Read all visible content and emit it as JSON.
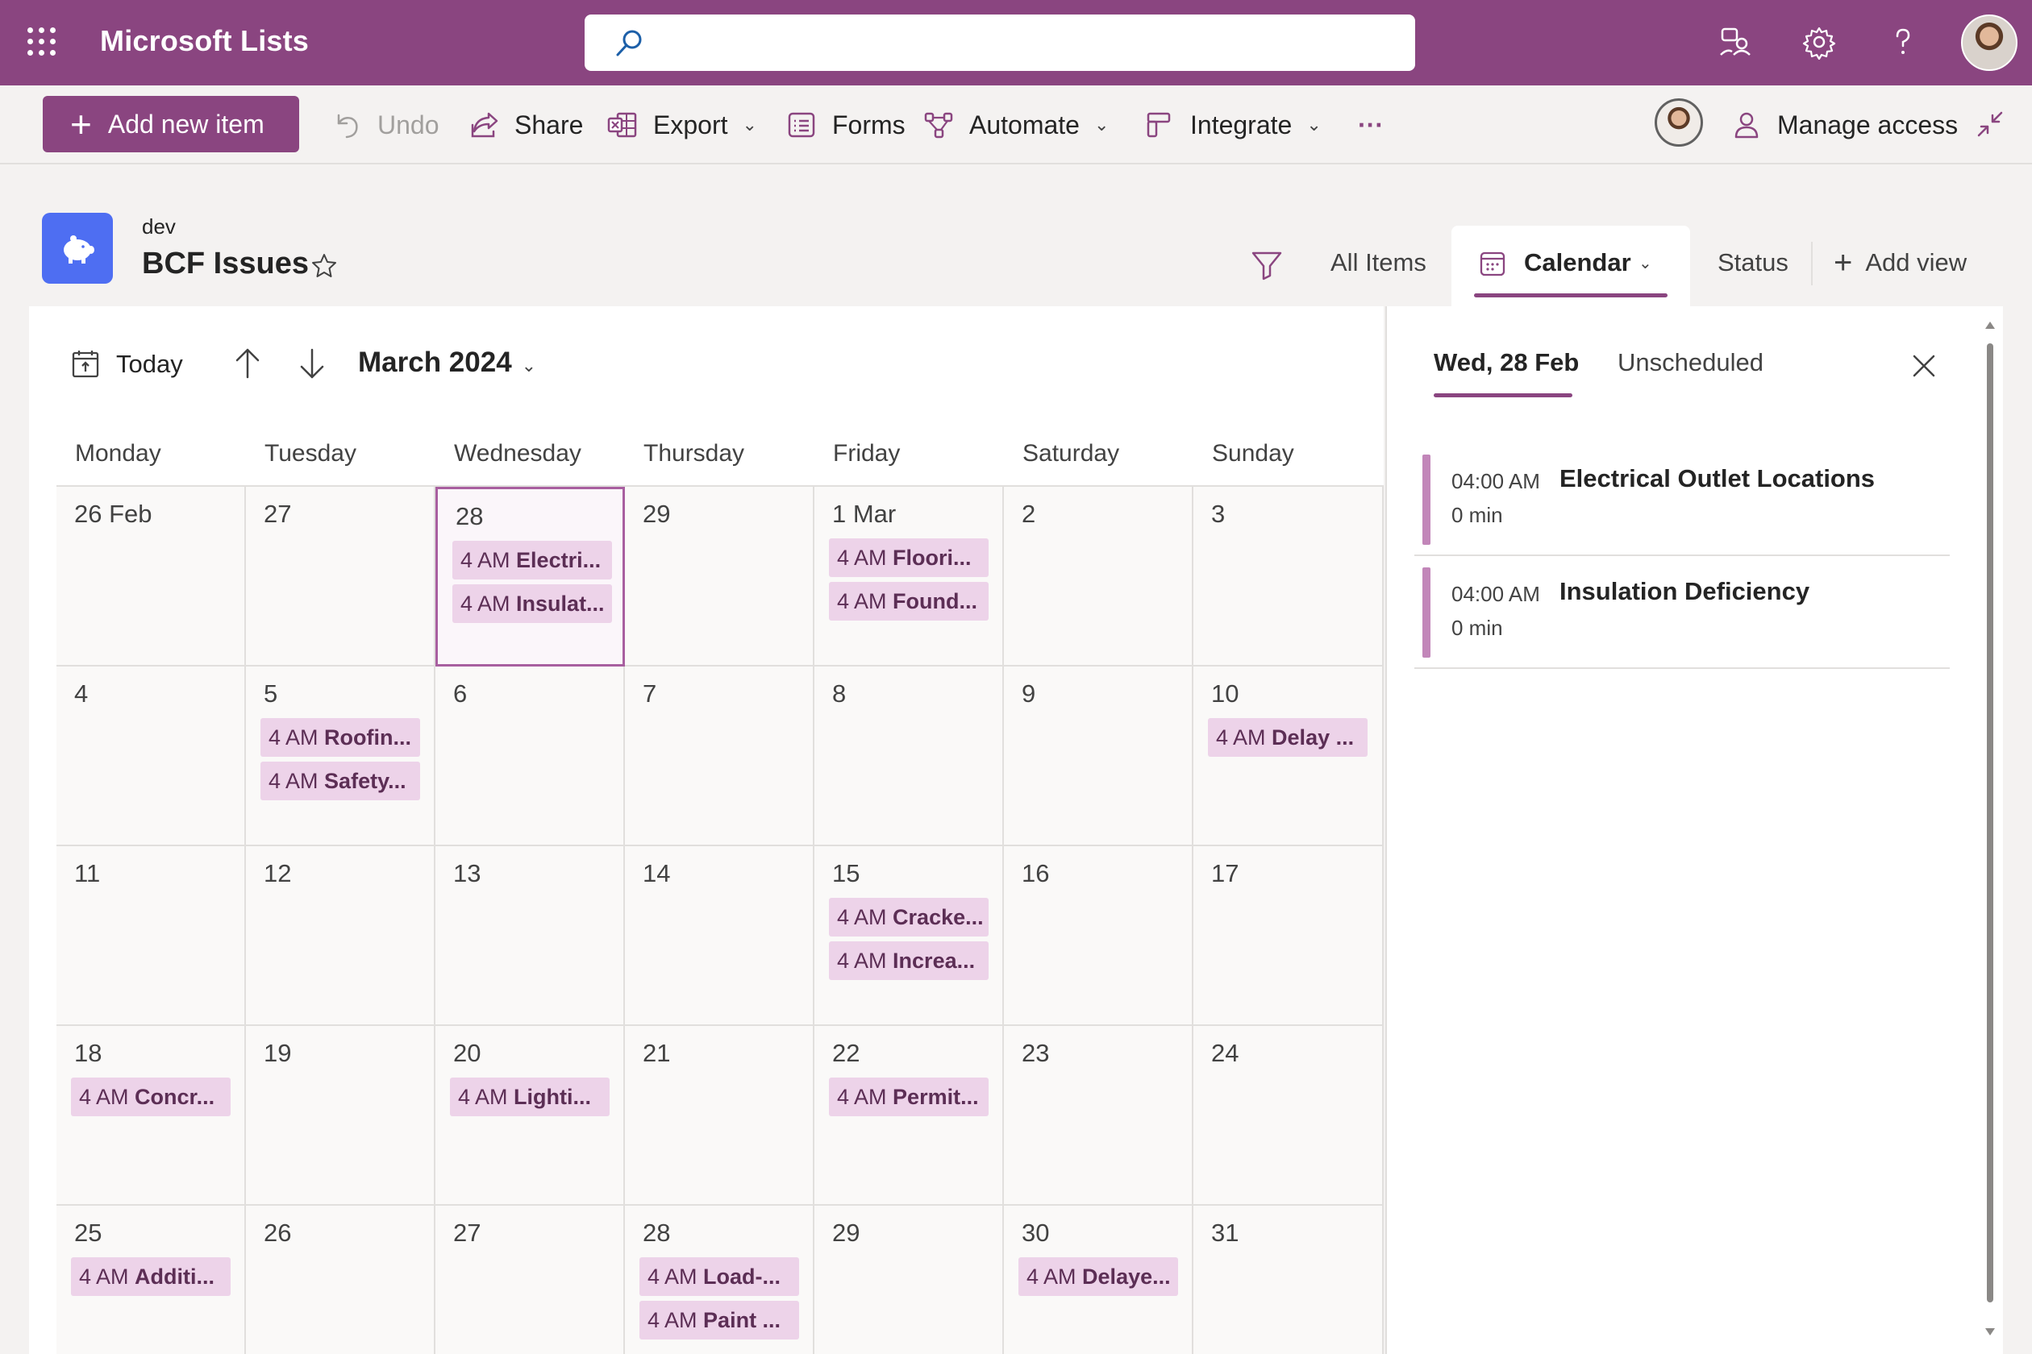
{
  "suite": {
    "app_title": "Microsoft Lists",
    "search_value": ""
  },
  "toolbar": {
    "add_label": "Add new item",
    "undo_label": "Undo",
    "share_label": "Share",
    "export_label": "Export",
    "forms_label": "Forms",
    "automate_label": "Automate",
    "integrate_label": "Integrate",
    "more_label": "···",
    "manage_access_label": "Manage access"
  },
  "list": {
    "parent": "dev",
    "title": "BCF Issues"
  },
  "views": {
    "all_items": "All Items",
    "calendar": "Calendar",
    "status": "Status",
    "add_view": "Add view"
  },
  "calendar": {
    "today_label": "Today",
    "month_label": "March 2024",
    "weekdays": [
      "Monday",
      "Tuesday",
      "Wednesday",
      "Thursday",
      "Friday",
      "Saturday",
      "Sunday"
    ],
    "weeks": [
      [
        {
          "day": "26 Feb",
          "events": []
        },
        {
          "day": "27",
          "events": []
        },
        {
          "day": "28",
          "selected": true,
          "events": [
            {
              "time": "4 AM",
              "name": "Electri..."
            },
            {
              "time": "4 AM",
              "name": "Insulat..."
            }
          ]
        },
        {
          "day": "29",
          "events": []
        },
        {
          "day": "1 Mar",
          "events": [
            {
              "time": "4 AM",
              "name": "Floori..."
            },
            {
              "time": "4 AM",
              "name": "Found..."
            }
          ]
        },
        {
          "day": "2",
          "events": []
        },
        {
          "day": "3",
          "events": []
        }
      ],
      [
        {
          "day": "4",
          "events": []
        },
        {
          "day": "5",
          "events": [
            {
              "time": "4 AM",
              "name": "Roofin..."
            },
            {
              "time": "4 AM",
              "name": "Safety..."
            }
          ]
        },
        {
          "day": "6",
          "events": []
        },
        {
          "day": "7",
          "events": []
        },
        {
          "day": "8",
          "events": []
        },
        {
          "day": "9",
          "events": []
        },
        {
          "day": "10",
          "events": [
            {
              "time": "4 AM",
              "name": "Delay ..."
            }
          ]
        }
      ],
      [
        {
          "day": "11",
          "events": []
        },
        {
          "day": "12",
          "events": []
        },
        {
          "day": "13",
          "events": []
        },
        {
          "day": "14",
          "events": []
        },
        {
          "day": "15",
          "events": [
            {
              "time": "4 AM",
              "name": "Cracke..."
            },
            {
              "time": "4 AM",
              "name": "Increa..."
            }
          ]
        },
        {
          "day": "16",
          "events": []
        },
        {
          "day": "17",
          "events": []
        }
      ],
      [
        {
          "day": "18",
          "events": [
            {
              "time": "4 AM",
              "name": "Concr..."
            }
          ]
        },
        {
          "day": "19",
          "events": []
        },
        {
          "day": "20",
          "events": [
            {
              "time": "4 AM",
              "name": "Lighti..."
            }
          ]
        },
        {
          "day": "21",
          "events": []
        },
        {
          "day": "22",
          "events": [
            {
              "time": "4 AM",
              "name": "Permit..."
            }
          ]
        },
        {
          "day": "23",
          "events": []
        },
        {
          "day": "24",
          "events": []
        }
      ],
      [
        {
          "day": "25",
          "events": [
            {
              "time": "4 AM",
              "name": "Additi..."
            }
          ]
        },
        {
          "day": "26",
          "events": []
        },
        {
          "day": "27",
          "events": []
        },
        {
          "day": "28",
          "events": [
            {
              "time": "4 AM",
              "name": "Load-..."
            },
            {
              "time": "4 AM",
              "name": "Paint ..."
            }
          ]
        },
        {
          "day": "29",
          "events": []
        },
        {
          "day": "30",
          "events": [
            {
              "time": "4 AM",
              "name": "Delaye..."
            }
          ]
        },
        {
          "day": "31",
          "events": []
        }
      ]
    ]
  },
  "side_panel": {
    "tab_date": "Wed, 28 Feb",
    "tab_unscheduled": "Unscheduled",
    "items": [
      {
        "time": "04:00 AM",
        "title": "Electrical Outlet Locations",
        "duration": "0 min"
      },
      {
        "time": "04:00 AM",
        "title": "Insulation Deficiency",
        "duration": "0 min"
      }
    ]
  },
  "colors": {
    "brand": "#8a4580",
    "event_bg": "#edd3e9",
    "event_text": "#5c2e55",
    "list_icon": "#4e6ef2"
  }
}
